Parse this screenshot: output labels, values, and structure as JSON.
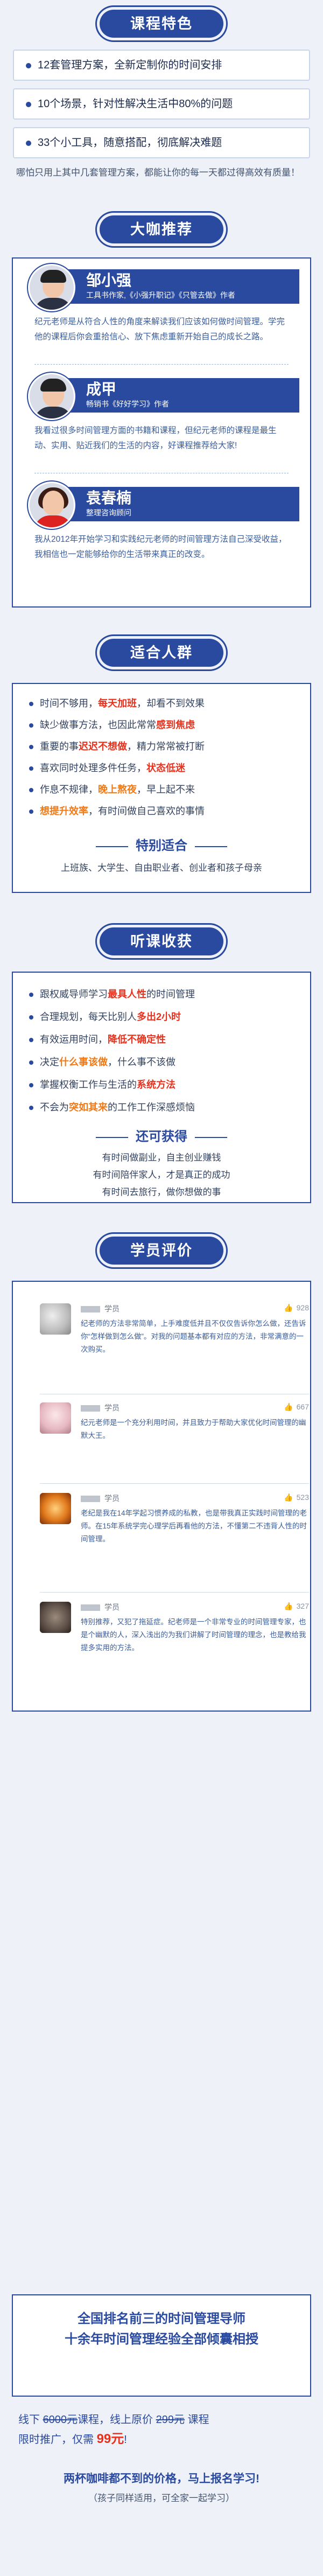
{
  "features": {
    "title": "课程特色",
    "items": [
      "12套管理方案，全新定制你的时间安排",
      "10个场景，针对性解决生活中80%的问题",
      "33个小工具，随意搭配，彻底解决难题"
    ],
    "summary": "哪怕只用上其中几套管理方案，都能让你的每一天都过得高效有质量！"
  },
  "experts": {
    "title": "大咖推荐",
    "people": [
      {
        "name": "邹小强",
        "role": "工具书作家,《小强升职记》《只管去做》作者",
        "bio": "纪元老师是从符合人性的角度来解读我们应该如何做时间管理。学完他的课程后你会重拾信心、放下焦虑重新开始自己的成长之路。"
      },
      {
        "name": "成甲",
        "role": "畅销书《好好学习》作者",
        "bio": "我看过很多时间管理方面的书籍和课程，但纪元老师的课程是最生动、实用、贴近我们的生活的内容，好课程推荐给大家!"
      },
      {
        "name": "袁春楠",
        "role": "整理咨询顾问",
        "bio": "我从2012年开始学习和实践纪元老师的时间管理方法自己深受收益，我相信也一定能够给你的生活带来真正的改变。"
      }
    ]
  },
  "audience": {
    "title": "适合人群",
    "items": [
      {
        "pre": "时间不够用，",
        "hl": "每天加班",
        "hl_color": "red",
        "post": "，却看不到效果"
      },
      {
        "pre": "缺少做事方法，也因此常常",
        "hl": "感到焦虑",
        "hl_color": "red",
        "post": ""
      },
      {
        "pre": "重要的事",
        "hl": "迟迟不想做",
        "hl_color": "red",
        "post": "，精力常常被打断"
      },
      {
        "pre": "喜欢同时处理多件任务，",
        "hl": "状态低迷",
        "hl_color": "red",
        "post": ""
      },
      {
        "pre": "作息不规律，",
        "hl": "晚上熬夜",
        "hl_color": "orange",
        "post": "，早上起不来"
      },
      {
        "pre": "",
        "hl": "想提升效率",
        "hl_color": "orange",
        "post": "，有时间做自己喜欢的事情"
      }
    ],
    "special_title": "特别适合",
    "special_text": "上班族、大学生、自由职业者、创业者和孩子母亲"
  },
  "gains": {
    "title": "听课收获",
    "items": [
      {
        "pre": "跟权威导师学习",
        "hl": "最具人性",
        "hl_color": "red",
        "post": "的时间管理"
      },
      {
        "pre": "合理规划，每天比别人",
        "hl": "多出2小时",
        "hl_color": "red",
        "post": ""
      },
      {
        "pre": "有效运用时间，",
        "hl": "降低不确定性",
        "hl_color": "red",
        "post": ""
      },
      {
        "pre": "决定",
        "hl": "什么事该做",
        "hl_color": "orange",
        "post": "，什么事不该做"
      },
      {
        "pre": "掌握权衡工作与生活的",
        "hl": "系统方法",
        "hl_color": "red",
        "post": ""
      },
      {
        "pre": "不会为",
        "hl": "突如其来",
        "hl_color": "orange",
        "post": "的工作工作深感烦恼"
      }
    ],
    "extra_title": "还可获得",
    "extra_lines": [
      "有时间做副业，自主创业赚钱",
      "有时间陪伴家人，才是真正的成功",
      "有时间去旅行，做你想做的事"
    ]
  },
  "reviews": {
    "title": "学员评价",
    "items": [
      {
        "label": "学员",
        "likes": "928",
        "text": "纪老师的方法非常简单，上手难度低并且不仅仅告诉你怎么做，还告诉你“怎样做到怎么做”。对我的问题基本都有对应的方法，非常满意的一次购买。"
      },
      {
        "label": "学员",
        "likes": "667",
        "text": "纪元老师是一个充分利用时间，并且致力于帮助大家优化时间管理的幽默大王。"
      },
      {
        "label": "学员",
        "likes": "523",
        "text": "老纪是我在14年学起习惯养成的私教，也是带我真正实践时间管理的老师。在15年系统学完心理学后再看他的方法，不懂第二不违背人性的时间管理。"
      },
      {
        "label": "学员",
        "likes": "327",
        "text": "特别推荐，又犯了拖延症。纪老师是一个非常专业的时间管理专家，也是个幽默的人，深入浅出的为我们讲解了时间管理的理念，也是教给我提多实用的方法。"
      }
    ]
  },
  "promo": {
    "headline1": "全国排名前三的时间管理导师",
    "headline2": "十余年时间管理经验全部倾囊相授",
    "price_line1_pre": "线下",
    "price_offline": "6000元",
    "price_line1_mid": "课程，线上原价",
    "price_original": "299元",
    "price_line1_post": "课程",
    "price_line2_pre": "限时推广，仅需",
    "price_now": "99元",
    "price_line2_post": "!",
    "tagline": "两杯咖啡都不到的价格，马上报名学习!",
    "tagsub": "（孩子同样适用，可全家一起学习）"
  },
  "colors": {
    "primary": "#2a4aa0",
    "highlight_red": "#e8321e",
    "highlight_orange": "#f07a17",
    "background": "#eef1f8"
  }
}
